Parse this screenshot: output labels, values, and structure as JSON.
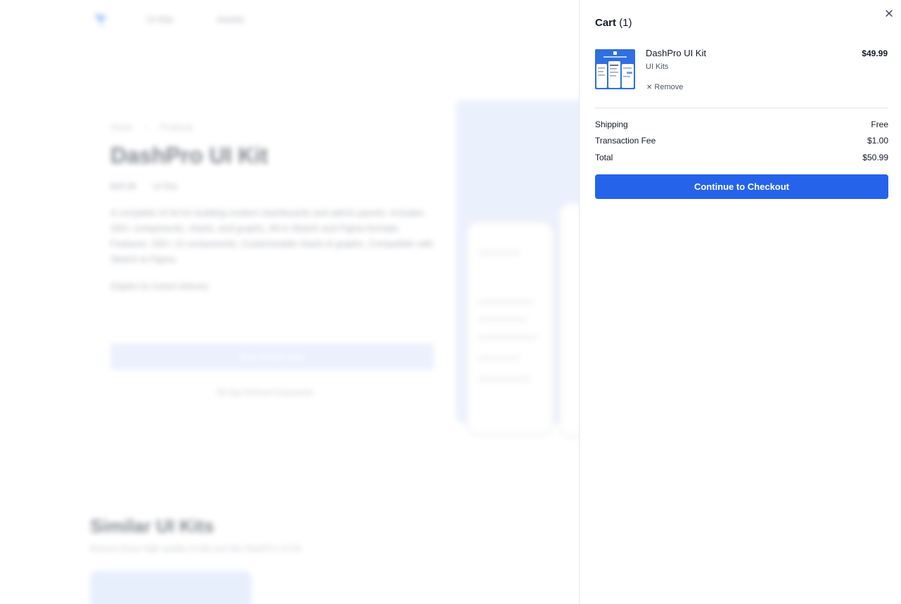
{
  "background": {
    "nav": {
      "item1": "UI Kits",
      "item2": "Assets"
    },
    "breadcrumb": [
      "Home",
      "Products"
    ],
    "product_title": "DashPro UI Kit",
    "meta": [
      "$49.99",
      "UI Kits"
    ],
    "description": "A complete UI kit for building modern dashboards and admin panels. Includes 200+ components, charts, and graphs. All in Sketch and Figma formats. Features: 200+ UI components, Customizable charts & graphs, Compatible with Sketch & Figma.",
    "eligible": "Eligible for instant delivery",
    "buy_label": "Buy UI Kit now",
    "guarantee": "30 day Refund Guarantee",
    "similar_title": "Similar UI Kits",
    "similar_subtitle": "Browse these high quality UI kits just like DashPro UI Kit"
  },
  "cart": {
    "title": "Cart",
    "count": "(1)",
    "close_icon": "close-icon",
    "items": [
      {
        "name": "DashPro UI Kit",
        "category": "UI Kits",
        "price": "$49.99",
        "remove_label": "Remove"
      }
    ],
    "summary": {
      "shipping_label": "Shipping",
      "shipping_value": "Free",
      "fee_label": "Transaction Fee",
      "fee_value": "$1.00",
      "total_label": "Total",
      "total_value": "$50.99"
    },
    "checkout_label": "Continue to Checkout"
  },
  "colors": {
    "accent": "#2563eb",
    "thumbnail_bg": "#2f6fe0"
  }
}
